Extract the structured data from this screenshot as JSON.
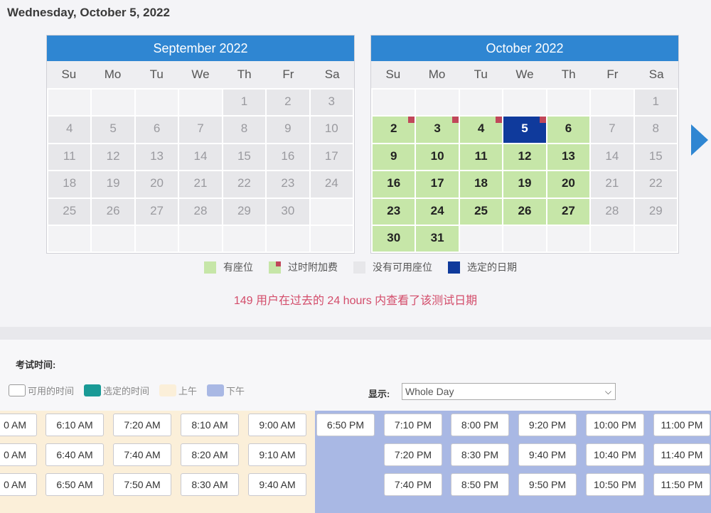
{
  "page_title": "Wednesday, October 5, 2022",
  "weekdays": [
    "Su",
    "Mo",
    "Tu",
    "We",
    "Th",
    "Fr",
    "Sa"
  ],
  "calendars": [
    {
      "title": "September 2022",
      "cells": [
        [
          "",
          "empty"
        ],
        [
          "",
          "empty"
        ],
        [
          "",
          "empty"
        ],
        [
          "",
          "empty"
        ],
        [
          "1",
          "n"
        ],
        [
          "2",
          "n"
        ],
        [
          "3",
          "n"
        ],
        [
          "4",
          "n"
        ],
        [
          "5",
          "n"
        ],
        [
          "6",
          "n"
        ],
        [
          "7",
          "n"
        ],
        [
          "8",
          "n"
        ],
        [
          "9",
          "n"
        ],
        [
          "10",
          "n"
        ],
        [
          "11",
          "n"
        ],
        [
          "12",
          "n"
        ],
        [
          "13",
          "n"
        ],
        [
          "14",
          "n"
        ],
        [
          "15",
          "n"
        ],
        [
          "16",
          "n"
        ],
        [
          "17",
          "n"
        ],
        [
          "18",
          "n"
        ],
        [
          "19",
          "n"
        ],
        [
          "20",
          "n"
        ],
        [
          "21",
          "n"
        ],
        [
          "22",
          "n"
        ],
        [
          "23",
          "n"
        ],
        [
          "24",
          "n"
        ],
        [
          "25",
          "n"
        ],
        [
          "26",
          "n"
        ],
        [
          "27",
          "n"
        ],
        [
          "28",
          "n"
        ],
        [
          "29",
          "n"
        ],
        [
          "30",
          "n"
        ],
        [
          "",
          "empty"
        ],
        [
          "",
          "empty"
        ],
        [
          "",
          "empty"
        ],
        [
          "",
          "empty"
        ],
        [
          "",
          "empty"
        ],
        [
          "",
          "empty"
        ],
        [
          "",
          "empty"
        ],
        [
          "",
          "empty"
        ]
      ]
    },
    {
      "title": "October 2022",
      "cells": [
        [
          "",
          "empty"
        ],
        [
          "",
          "empty"
        ],
        [
          "",
          "empty"
        ],
        [
          "",
          "empty"
        ],
        [
          "",
          "empty"
        ],
        [
          "",
          "empty"
        ],
        [
          "1",
          "n"
        ],
        [
          "2",
          "avail-fee"
        ],
        [
          "3",
          "avail-fee"
        ],
        [
          "4",
          "avail-fee"
        ],
        [
          "5",
          "selected-fee"
        ],
        [
          "6",
          "avail"
        ],
        [
          "7",
          "n"
        ],
        [
          "8",
          "n"
        ],
        [
          "9",
          "avail"
        ],
        [
          "10",
          "avail"
        ],
        [
          "11",
          "avail"
        ],
        [
          "12",
          "avail"
        ],
        [
          "13",
          "avail"
        ],
        [
          "14",
          "n"
        ],
        [
          "15",
          "n"
        ],
        [
          "16",
          "avail"
        ],
        [
          "17",
          "avail"
        ],
        [
          "18",
          "avail"
        ],
        [
          "19",
          "avail"
        ],
        [
          "20",
          "avail"
        ],
        [
          "21",
          "n"
        ],
        [
          "22",
          "n"
        ],
        [
          "23",
          "avail"
        ],
        [
          "24",
          "avail"
        ],
        [
          "25",
          "avail"
        ],
        [
          "26",
          "avail"
        ],
        [
          "27",
          "avail"
        ],
        [
          "28",
          "n"
        ],
        [
          "29",
          "n"
        ],
        [
          "30",
          "avail"
        ],
        [
          "31",
          "avail"
        ],
        [
          "",
          "empty"
        ],
        [
          "",
          "empty"
        ],
        [
          "",
          "empty"
        ],
        [
          "",
          "empty"
        ],
        [
          "",
          "empty"
        ]
      ]
    }
  ],
  "legend": {
    "available": "有座位",
    "late_fee": "过时附加费",
    "no_seats": "没有可用座位",
    "selected_date": "选定的日期"
  },
  "views_note": "149 用户在过去的 24 hours 内查看了该测试日期",
  "exam_time_label": "考试时间:",
  "time_legend": {
    "available_time": "可用的时间",
    "selected_time": "选定的时间",
    "am": "上午",
    "pm": "下午"
  },
  "show_label": "显示:",
  "show_value": "Whole Day",
  "colors": {
    "header_blue": "#2f86d2",
    "available_green": "#c6e6a8",
    "selected_navy": "#0f3a9c",
    "late_fee_red": "#c0475a",
    "am_band": "#fbefd9",
    "pm_band": "#a9b8e4",
    "selected_time_teal": "#1a9a96"
  },
  "time_slots": {
    "am": [
      [
        "0 AM",
        "6:10 AM",
        "7:20 AM",
        "8:10 AM",
        "9:00 AM"
      ],
      [
        "0 AM",
        "6:40 AM",
        "7:40 AM",
        "8:20 AM",
        "9:10 AM"
      ],
      [
        "0 AM",
        "6:50 AM",
        "7:50 AM",
        "8:30 AM",
        "9:40 AM"
      ]
    ],
    "pm": [
      [
        "6:50 PM",
        "7:10 PM",
        "8:00 PM",
        "9:20 PM",
        "10:00 PM",
        "11:00 PM"
      ],
      [
        "",
        "7:20 PM",
        "8:30 PM",
        "9:40 PM",
        "10:40 PM",
        "11:40 PM"
      ],
      [
        "",
        "7:40 PM",
        "8:50 PM",
        "9:50 PM",
        "10:50 PM",
        "11:50 PM"
      ]
    ]
  }
}
